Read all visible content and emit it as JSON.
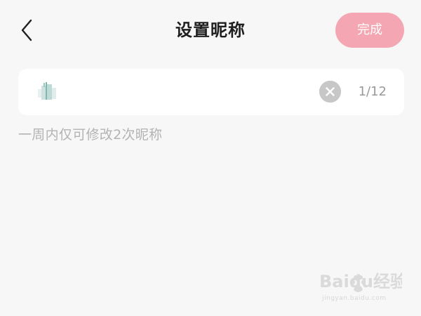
{
  "header": {
    "title": "设置昵称",
    "done_label": "完成"
  },
  "colors": {
    "background": "#f7f7f7",
    "accent_pink": "#f4a7b2",
    "clear_icon": "#c7c7c7",
    "hint_text": "#b3b3b3",
    "counter_text": "#999999"
  },
  "nickname_field": {
    "value": "",
    "counter": "1/12",
    "clear_icon": "close-circle-icon"
  },
  "hint": "一周内仅可修改2次昵称",
  "watermark": {
    "brand": "Baidu经验",
    "url": "jingyan.baidu.com"
  }
}
